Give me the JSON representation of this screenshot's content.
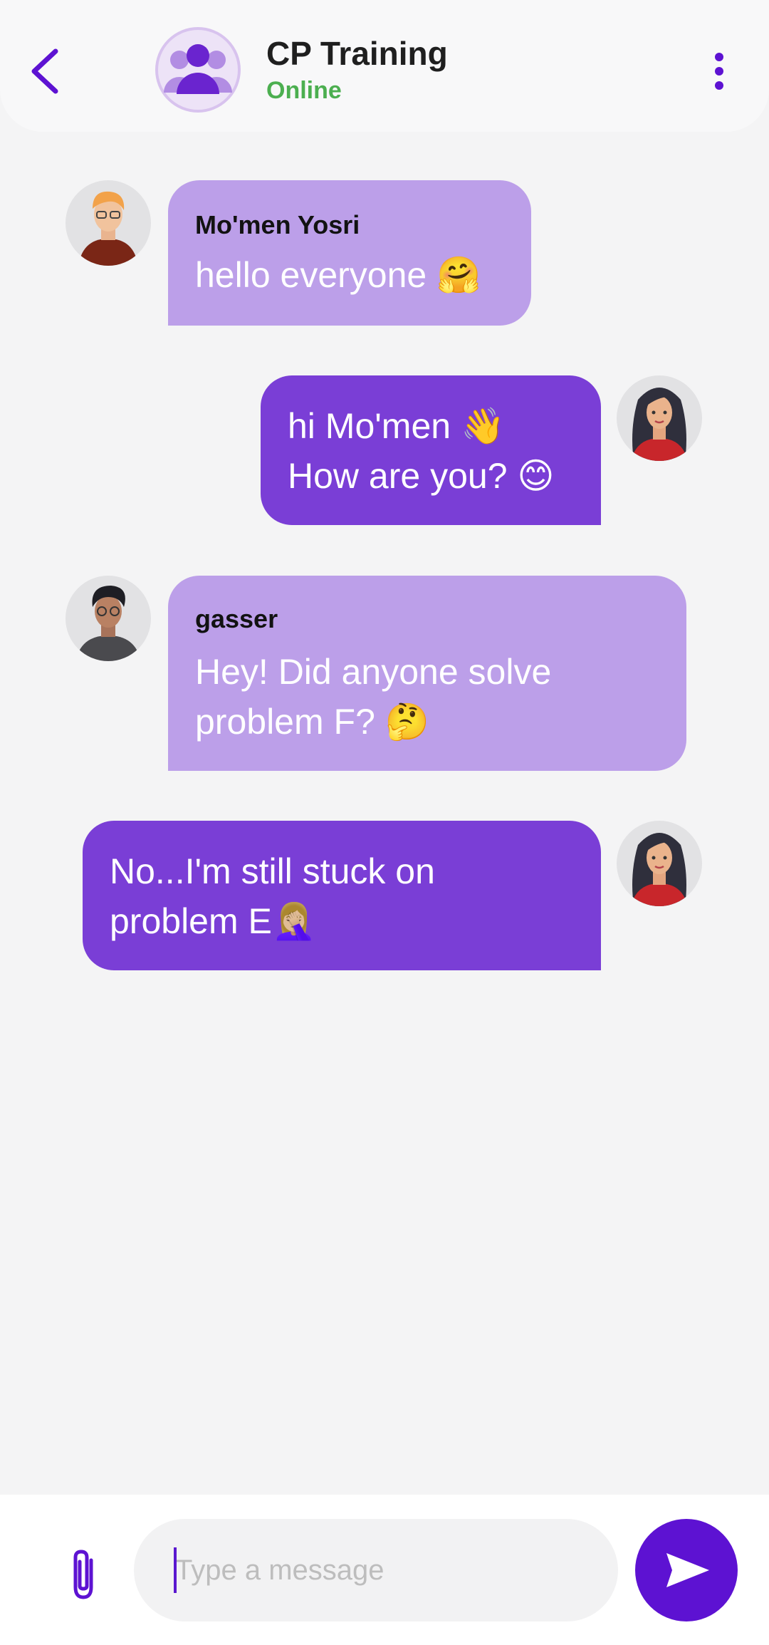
{
  "header": {
    "title": "CP Training",
    "status": "Online",
    "back_icon": "chevron-left-icon",
    "menu_icon": "more-vertical-icon",
    "avatar_icon": "group-icon"
  },
  "messages": [
    {
      "direction": "incoming",
      "sender": "Mo'men Yosri",
      "lines": [
        "hello everyone 🤗"
      ]
    },
    {
      "direction": "outgoing",
      "lines": [
        "hi Mo'men 👋",
        "How are you? 😊"
      ]
    },
    {
      "direction": "incoming",
      "sender": "gasser",
      "lines": [
        "Hey! Did anyone solve",
        "problem F? 🤔"
      ]
    },
    {
      "direction": "outgoing",
      "lines": [
        "No...I'm still stuck on",
        "problem E🤦🏼‍♀️"
      ]
    }
  ],
  "composer": {
    "placeholder": "Type a message",
    "attach_icon": "paperclip-icon",
    "send_icon": "send-icon"
  },
  "colors": {
    "accent": "#5d12d2",
    "incoming_bubble": "#bc9fe9",
    "outgoing_bubble": "#7a3ed6",
    "online": "#4caf50"
  }
}
